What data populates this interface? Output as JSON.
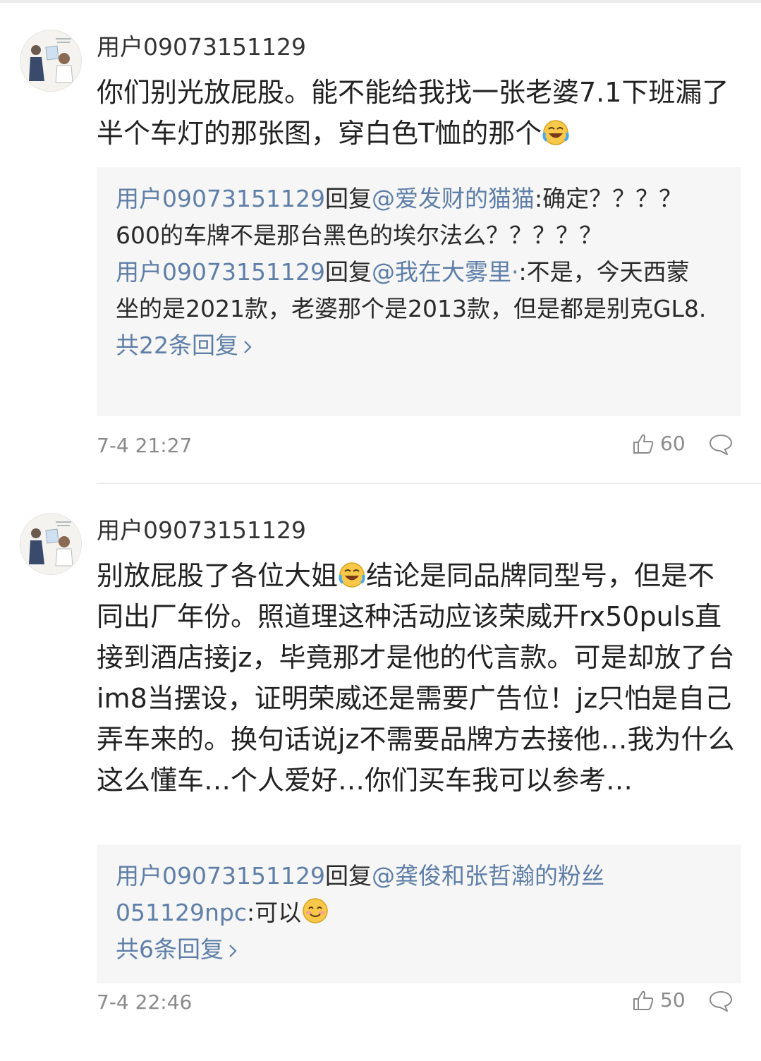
{
  "comments": [
    {
      "username": "用户09073151129",
      "body_before_emoji": "你们别光放屁股。能不能给我找一张老婆7.1下班漏了半个车灯的那张图，穿白色T恤的那个",
      "body_emoji": "laughing-crying-emoji",
      "replies": [
        {
          "from": "用户09073151129",
          "verb": "回复",
          "to": "@爱发财的猫猫",
          "text": ":确定？？？？600的车牌不是那台黑色的埃尔法么？？？？？"
        },
        {
          "from": "用户09073151129",
          "verb": "回复",
          "to": "@我在大雾里·",
          "text": ":不是，今天西蒙坐的是2021款，老婆那个是2013款，但是都是别克GL8."
        }
      ],
      "more_replies": "共22条回复",
      "time": "7-4 21:27",
      "likes": "60"
    },
    {
      "username": "用户09073151129",
      "body_part1": "别放屁股了各位大姐",
      "body_emoji": "laughing-crying-emoji",
      "body_part2": "结论是同品牌同型号，但是不同出厂年份。照道理这种活动应该荣威开rx50puls直接到酒店接jz，毕竟那才是他的代言款。可是却放了台im8当摆设，证明荣威还是需要广告位！jz只怕是自己弄车来的。换句话说jz不需要品牌方去接他…我为什么这么懂车…个人爱好…你们买车我可以参考…",
      "replies": [
        {
          "from": "用户09073151129",
          "verb": "回复",
          "to": "@龚俊和张哲瀚的粉丝051129npc",
          "text": ":可以",
          "emoji": "smiling-emoji"
        }
      ],
      "more_replies": "共6条回复",
      "time": "7-4 22:46",
      "likes": "50"
    }
  ],
  "colors": {
    "link": "#5f7fa8",
    "meta": "#8a8a8a",
    "reply_bg": "#f6f6f6"
  }
}
